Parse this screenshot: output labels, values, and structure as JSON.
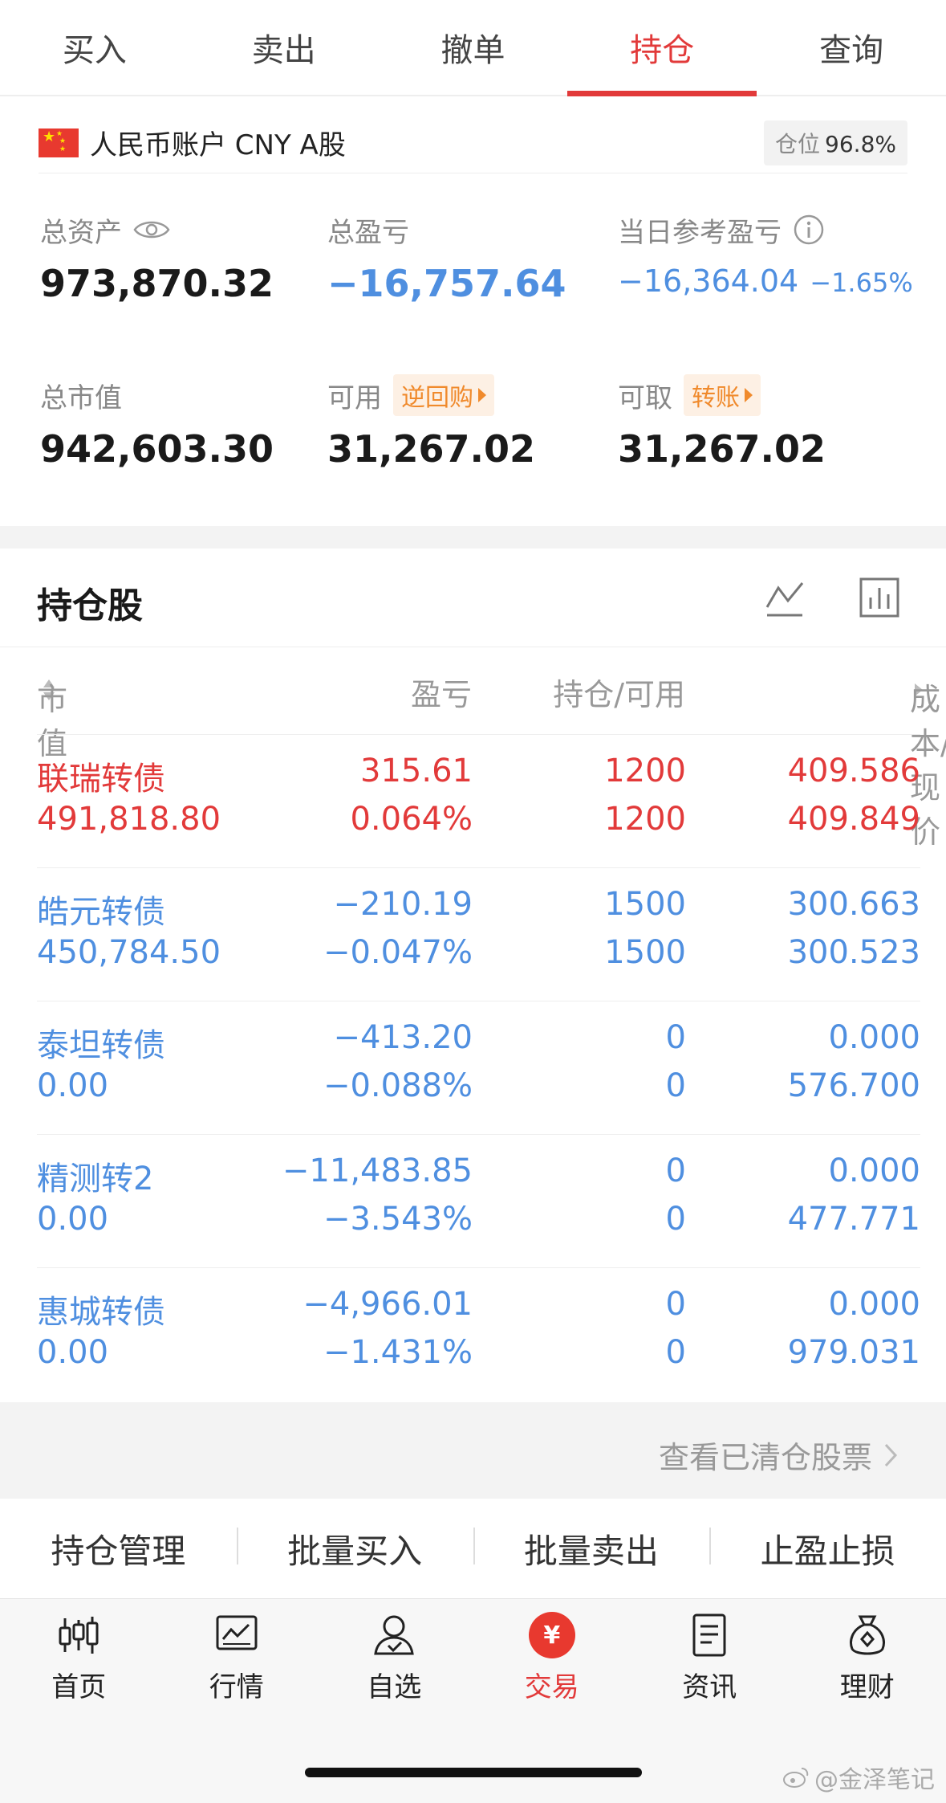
{
  "tabs": [
    {
      "label": "买入"
    },
    {
      "label": "卖出"
    },
    {
      "label": "撤单"
    },
    {
      "label": "持仓"
    },
    {
      "label": "查询"
    }
  ],
  "account": {
    "name": "人民币账户 CNY A股",
    "position_label": "仓位",
    "position_value": "96.8%"
  },
  "stats": {
    "total_assets_label": "总资产",
    "total_assets": "973,870.32",
    "total_pnl_label": "总盈亏",
    "total_pnl": "−16,757.64",
    "daily_pnl_label": "当日参考盈亏",
    "daily_pnl": "−16,364.04",
    "daily_pnl_pct": "−1.65%",
    "market_value_label": "总市值",
    "market_value": "942,603.30",
    "available_label": "可用",
    "available_tag": "逆回购",
    "available": "31,267.02",
    "withdrawable_label": "可取",
    "withdrawable_tag": "转账",
    "withdrawable": "31,267.02"
  },
  "holdings": {
    "title": "持仓股",
    "columns": {
      "market_value": "市值",
      "pnl": "盈亏",
      "hold_avail": "持仓/可用",
      "cost_price": "成本/现价"
    },
    "rows": [
      {
        "name": "联瑞转债",
        "market_value": "491,818.80",
        "pnl": "315.61",
        "pnl_pct": "0.064%",
        "hold": "1200",
        "avail": "1200",
        "cost": "409.586",
        "price": "409.849"
      },
      {
        "name": "皓元转债",
        "market_value": "450,784.50",
        "pnl": "−210.19",
        "pnl_pct": "−0.047%",
        "hold": "1500",
        "avail": "1500",
        "cost": "300.663",
        "price": "300.523"
      },
      {
        "name": "泰坦转债",
        "market_value": "0.00",
        "pnl": "−413.20",
        "pnl_pct": "−0.088%",
        "hold": "0",
        "avail": "0",
        "cost": "0.000",
        "price": "576.700"
      },
      {
        "name": "精测转2",
        "market_value": "0.00",
        "pnl": "−11,483.85",
        "pnl_pct": "−3.543%",
        "hold": "0",
        "avail": "0",
        "cost": "0.000",
        "price": "477.771"
      },
      {
        "name": "惠城转债",
        "market_value": "0.00",
        "pnl": "−4,966.01",
        "pnl_pct": "−1.431%",
        "hold": "0",
        "avail": "0",
        "cost": "0.000",
        "price": "979.031"
      }
    ]
  },
  "cleared_link": "查看已清仓股票",
  "actions": [
    "持仓管理",
    "批量买入",
    "批量卖出",
    "止盈止损"
  ],
  "bottom_nav": [
    {
      "label": "首页",
      "icon": "candlestick-icon"
    },
    {
      "label": "行情",
      "icon": "market-chart-icon"
    },
    {
      "label": "自选",
      "icon": "user-select-icon"
    },
    {
      "label": "交易",
      "icon": "yen-icon",
      "glyph": "¥"
    },
    {
      "label": "资讯",
      "icon": "news-doc-icon"
    },
    {
      "label": "理财",
      "icon": "money-bag-icon"
    }
  ],
  "watermark": "@金泽笔记",
  "colors": {
    "up": "#e23a3a",
    "down": "#4f8fe0",
    "accent": "#e23a3a",
    "tag": "#f08a2c"
  }
}
